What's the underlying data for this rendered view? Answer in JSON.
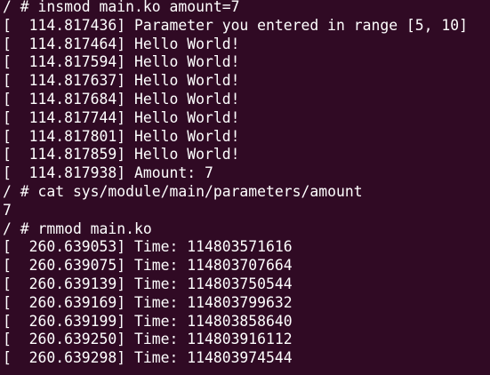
{
  "terminal": {
    "lines": [
      "/ # insmod main.ko amount=7",
      "[  114.817436] Parameter you entered in range [5, 10]",
      "[  114.817464] Hello World!",
      "[  114.817594] Hello World!",
      "[  114.817637] Hello World!",
      "[  114.817684] Hello World!",
      "[  114.817744] Hello World!",
      "[  114.817801] Hello World!",
      "[  114.817859] Hello World!",
      "[  114.817938] Amount: 7",
      "/ # cat sys/module/main/parameters/amount",
      "7",
      "/ # rmmod main.ko",
      "[  260.639053] Time: 114803571616",
      "[  260.639075] Time: 114803707664",
      "[  260.639139] Time: 114803750544",
      "[  260.639169] Time: 114803799632",
      "[  260.639199] Time: 114803858640",
      "[  260.639250] Time: 114803916112",
      "[  260.639298] Time: 114803974544"
    ]
  }
}
